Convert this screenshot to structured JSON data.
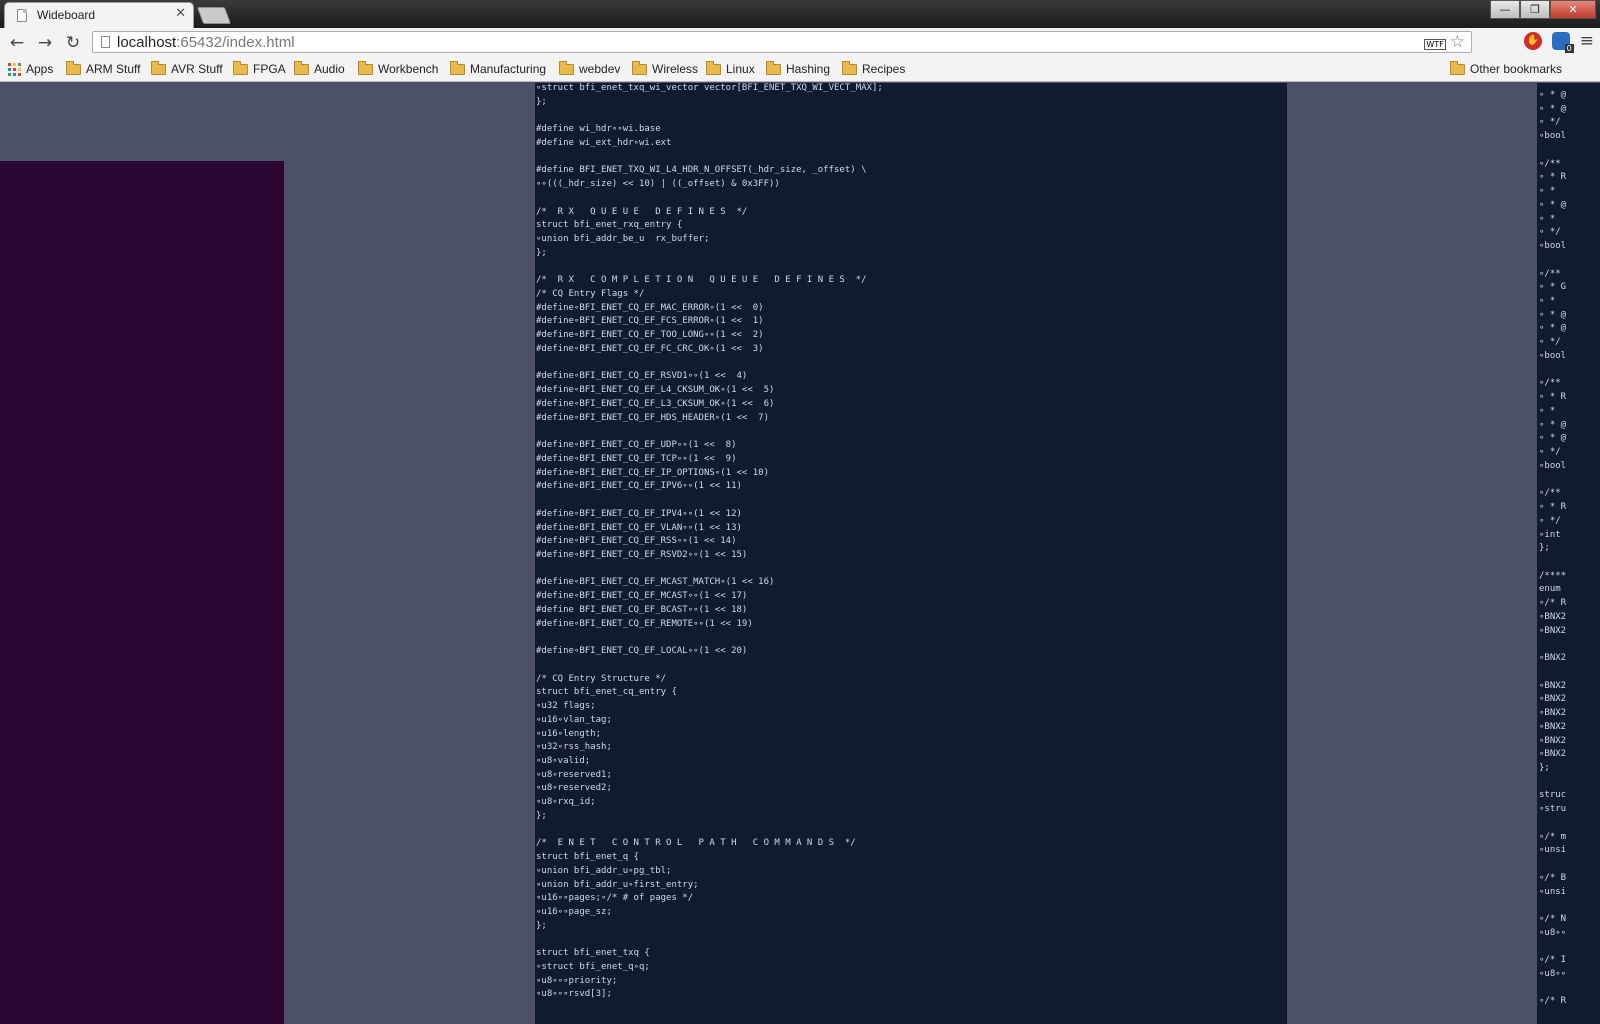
{
  "browser": {
    "tab_title": "Wideboard",
    "tab_close": "✕",
    "url_host": "localhost",
    "url_rest": ":65432/index.html",
    "wtf_label": "WTF",
    "ext_badge": "0",
    "window_controls": {
      "minimize": "—",
      "maximize": "❐",
      "close": "✕"
    },
    "nav": {
      "back": "←",
      "forward": "→",
      "reload": "↻"
    }
  },
  "bookmarks": [
    {
      "label": "Apps",
      "icon": "apps-grid-icon"
    },
    {
      "label": "ARM Stuff",
      "icon": "folder-icon"
    },
    {
      "label": "AVR Stuff",
      "icon": "folder-icon"
    },
    {
      "label": "FPGA",
      "icon": "folder-icon"
    },
    {
      "label": "Audio",
      "icon": "folder-icon"
    },
    {
      "label": "Workbench",
      "icon": "folder-icon"
    },
    {
      "label": "Manufacturing",
      "icon": "folder-icon"
    },
    {
      "label": "webdev",
      "icon": "folder-icon"
    },
    {
      "label": "Wireless",
      "icon": "folder-icon"
    },
    {
      "label": "Linux",
      "icon": "folder-icon"
    },
    {
      "label": "Hashing",
      "icon": "folder-icon"
    },
    {
      "label": "Recipes",
      "icon": "folder-icon"
    }
  ],
  "other_bookmarks": "Other bookmarks",
  "code_main": [
    "∘struct bfi_enet_txq_wi_vector vector[BFI_ENET_TXQ_WI_VECT_MAX];",
    "};",
    "",
    "#define wi_hdr∘∘wi.base",
    "#define wi_ext_hdr∘wi.ext",
    "",
    "#define BFI_ENET_TXQ_WI_L4_HDR_N_OFFSET(_hdr_size, _offset) \\",
    "∘∘(((_hdr_size) << 10) | ((_offset) & 0x3FF))",
    "",
    "/*  R X   Q U E U E   D E F I N E S  */",
    "struct bfi_enet_rxq_entry {",
    "∘union bfi_addr_be_u  rx_buffer;",
    "};",
    "",
    "/*  R X   C O M P L E T I O N   Q U E U E   D E F I N E S  */",
    "/* CQ Entry Flags */",
    "#define∘BFI_ENET_CQ_EF_MAC_ERROR∘(1 <<  0)",
    "#define∘BFI_ENET_CQ_EF_FCS_ERROR∘(1 <<  1)",
    "#define∘BFI_ENET_CQ_EF_TOO_LONG∘∘(1 <<  2)",
    "#define∘BFI_ENET_CQ_EF_FC_CRC_OK∘(1 <<  3)",
    "",
    "#define∘BFI_ENET_CQ_EF_RSVD1∘∘(1 <<  4)",
    "#define∘BFI_ENET_CQ_EF_L4_CKSUM_OK∘(1 <<  5)",
    "#define∘BFI_ENET_CQ_EF_L3_CKSUM_OK∘(1 <<  6)",
    "#define∘BFI_ENET_CQ_EF_HDS_HEADER∘(1 <<  7)",
    "",
    "#define∘BFI_ENET_CQ_EF_UDP∘∘(1 <<  8)",
    "#define∘BFI_ENET_CQ_EF_TCP∘∘(1 <<  9)",
    "#define∘BFI_ENET_CQ_EF_IP_OPTIONS∘(1 << 10)",
    "#define∘BFI_ENET_CQ_EF_IPV6∘∘(1 << 11)",
    "",
    "#define∘BFI_ENET_CQ_EF_IPV4∘∘(1 << 12)",
    "#define∘BFI_ENET_CQ_EF_VLAN∘∘(1 << 13)",
    "#define∘BFI_ENET_CQ_EF_RSS∘∘(1 << 14)",
    "#define∘BFI_ENET_CQ_EF_RSVD2∘∘(1 << 15)",
    "",
    "#define∘BFI_ENET_CQ_EF_MCAST_MATCH∘(1 << 16)",
    "#define∘BFI_ENET_CQ_EF_MCAST∘∘(1 << 17)",
    "#define BFI_ENET_CQ_EF_BCAST∘∘(1 << 18)",
    "#define∘BFI_ENET_CQ_EF_REMOTE∘∘(1 << 19)",
    "",
    "#define∘BFI_ENET_CQ_EF_LOCAL∘∘(1 << 20)",
    "",
    "/* CQ Entry Structure */",
    "struct bfi_enet_cq_entry {",
    "∘u32 flags;",
    "∘u16∘vlan_tag;",
    "∘u16∘length;",
    "∘u32∘rss_hash;",
    "∘u8∘valid;",
    "∘u8∘reserved1;",
    "∘u8∘reserved2;",
    "∘u8∘rxq_id;",
    "};",
    "",
    "/*  E N E T   C O N T R O L   P A T H   C O M M A N D S  */",
    "struct bfi_enet_q {",
    "∘union bfi_addr_u∘pg_tbl;",
    "∘union bfi_addr_u∘first_entry;",
    "∘u16∘∘pages;∘/* # of pages */",
    "∘u16∘∘page_sz;",
    "};",
    "",
    "struct bfi_enet_txq {",
    "∘struct bfi_enet_q∘q;",
    "∘u8∘∘∘priority;",
    "∘u8∘∘∘rsvd[3];"
  ],
  "code_side": [
    "∘ * @",
    "∘ * @",
    "∘ */",
    "∘bool",
    "",
    "∘/**",
    "∘ * R",
    "∘ *",
    "∘ * @",
    "∘ *",
    "∘ */",
    "∘bool",
    "",
    "∘/**",
    "∘ * G",
    "∘ *",
    "∘ * @",
    "∘ * @",
    "∘ */",
    "∘bool",
    "",
    "∘/**",
    "∘ * R",
    "∘ *",
    "∘ * @",
    "∘ * @",
    "∘ */",
    "∘bool",
    "",
    "∘/**",
    "∘ * R",
    "∘ */",
    "∘int",
    "};",
    "",
    "/****",
    "enum",
    "∘/* R",
    "∘BNX2",
    "∘BNX2",
    "",
    "∘BNX2",
    "",
    "∘BNX2",
    "∘BNX2",
    "∘BNX2",
    "∘BNX2",
    "∘BNX2",
    "∘BNX2",
    "};",
    "",
    "struc",
    "∘stru",
    "",
    "∘/* m",
    "∘unsi",
    "",
    "∘/* B",
    "∘unsi",
    "",
    "∘/* N",
    "∘u8∘∘",
    "",
    "∘/* I",
    "∘u8∘∘",
    "",
    "∘/* R"
  ]
}
